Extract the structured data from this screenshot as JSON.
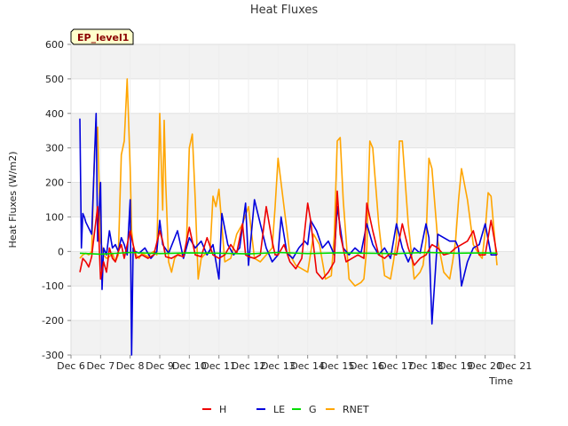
{
  "chart_data": {
    "type": "line",
    "title": "Heat Fluxes",
    "badge": "EP_level1",
    "xlabel": "Time",
    "ylabel": "Heat Fluxes (W/m2)",
    "xlim": [
      6,
      21
    ],
    "ylim": [
      -300,
      600
    ],
    "x_ticks": [
      6,
      7,
      8,
      9,
      10,
      11,
      12,
      13,
      14,
      15,
      16,
      17,
      18,
      19,
      20,
      21
    ],
    "x_tick_labels": [
      "Dec 6",
      "Dec 7",
      "Dec 8",
      "Dec 9",
      "Dec 10",
      "Dec 11",
      "Dec 12",
      "Dec 13",
      "Dec 14",
      "Dec 15",
      "Dec 16",
      "Dec 17",
      "Dec 18",
      "Dec 19",
      "Dec 20",
      "Dec 21"
    ],
    "y_ticks": [
      -300,
      -200,
      -100,
      0,
      100,
      200,
      300,
      400,
      500,
      600
    ],
    "y_tick_labels": [
      "-300",
      "-200",
      "-100",
      "0",
      "100",
      "200",
      "300",
      "400",
      "500",
      "600"
    ],
    "grid": true,
    "legend_position": "bottom",
    "series": [
      {
        "name": "H",
        "color": "#ee0000",
        "x": [
          6.3,
          6.4,
          6.5,
          6.6,
          6.7,
          6.8,
          6.9,
          7.0,
          7.1,
          7.2,
          7.3,
          7.4,
          7.5,
          7.6,
          7.7,
          7.8,
          8.0,
          8.2,
          8.4,
          8.6,
          8.8,
          9.0,
          9.1,
          9.2,
          9.4,
          9.6,
          9.8,
          10.0,
          10.2,
          10.4,
          10.6,
          10.8,
          11.0,
          11.2,
          11.4,
          11.6,
          11.8,
          11.9,
          12.0,
          12.2,
          12.4,
          12.6,
          12.8,
          12.9,
          13.0,
          13.2,
          13.4,
          13.6,
          13.8,
          14.0,
          14.1,
          14.3,
          14.5,
          14.7,
          14.9,
          15.0,
          15.1,
          15.3,
          15.5,
          15.7,
          15.9,
          16.0,
          16.2,
          16.4,
          16.6,
          16.8,
          17.0,
          17.2,
          17.4,
          17.6,
          17.8,
          18.0,
          18.2,
          18.4,
          18.6,
          18.8,
          19.0,
          19.2,
          19.4,
          19.6,
          19.8,
          20.0,
          20.2,
          20.4
        ],
        "y": [
          -60,
          -20,
          -30,
          -45,
          -15,
          60,
          130,
          -80,
          -30,
          -60,
          10,
          -20,
          -30,
          0,
          20,
          -20,
          60,
          -20,
          -10,
          -20,
          -10,
          60,
          30,
          -15,
          -20,
          -10,
          -15,
          70,
          -10,
          -15,
          40,
          -10,
          -20,
          -10,
          20,
          -5,
          80,
          -10,
          -15,
          -20,
          -10,
          130,
          30,
          -10,
          -10,
          20,
          -30,
          -50,
          -20,
          140,
          90,
          -60,
          -80,
          -60,
          -30,
          175,
          50,
          -30,
          -20,
          -10,
          -20,
          140,
          60,
          -10,
          -20,
          -5,
          -10,
          80,
          10,
          -40,
          -20,
          -10,
          20,
          10,
          -10,
          -5,
          10,
          20,
          30,
          60,
          -10,
          -10,
          90,
          -10
        ],
        "lw": 1.6
      },
      {
        "name": "LE",
        "color": "#0000dd",
        "x": [
          6.3,
          6.35,
          6.4,
          6.45,
          6.5,
          6.7,
          6.85,
          6.9,
          7.0,
          7.05,
          7.1,
          7.2,
          7.3,
          7.4,
          7.5,
          7.6,
          7.7,
          7.8,
          7.9,
          8.0,
          8.05,
          8.1,
          8.15,
          8.3,
          8.5,
          8.7,
          8.9,
          9.0,
          9.1,
          9.3,
          9.6,
          9.8,
          10.0,
          10.2,
          10.4,
          10.6,
          10.8,
          11.0,
          11.1,
          11.3,
          11.5,
          11.7,
          11.9,
          12.0,
          12.2,
          12.4,
          12.6,
          12.8,
          13.0,
          13.1,
          13.3,
          13.5,
          13.7,
          13.9,
          14.0,
          14.1,
          14.3,
          14.5,
          14.7,
          14.9,
          15.0,
          15.2,
          15.4,
          15.6,
          15.8,
          16.0,
          16.2,
          16.4,
          16.6,
          16.8,
          17.0,
          17.2,
          17.4,
          17.6,
          17.8,
          18.0,
          18.1,
          18.2,
          18.4,
          18.6,
          18.8,
          19.0,
          19.1,
          19.2,
          19.4,
          19.6,
          19.8,
          20.0,
          20.2,
          20.4
        ],
        "y": [
          385,
          10,
          110,
          100,
          85,
          50,
          400,
          30,
          200,
          -110,
          10,
          -10,
          60,
          10,
          20,
          0,
          40,
          20,
          -10,
          150,
          -300,
          10,
          0,
          -5,
          10,
          -20,
          0,
          90,
          20,
          -5,
          60,
          -20,
          40,
          10,
          30,
          -10,
          20,
          -80,
          110,
          20,
          -10,
          10,
          140,
          -40,
          150,
          80,
          10,
          -30,
          -10,
          100,
          -5,
          -20,
          10,
          30,
          20,
          90,
          60,
          10,
          30,
          -10,
          130,
          10,
          -10,
          10,
          -5,
          80,
          20,
          -10,
          10,
          -20,
          80,
          10,
          -30,
          10,
          -5,
          80,
          40,
          -210,
          50,
          40,
          30,
          30,
          10,
          -100,
          -30,
          10,
          20,
          80,
          -10,
          -10
        ],
        "lw": 1.6
      },
      {
        "name": "G",
        "color": "#00dd00",
        "x": [
          6.3,
          7.0,
          8.0,
          9.0,
          10.0,
          11.0,
          12.0,
          13.0,
          14.0,
          15.0,
          16.0,
          17.0,
          18.0,
          19.0,
          20.0,
          20.4
        ],
        "y": [
          -5,
          -8,
          -3,
          -6,
          -4,
          -5,
          -7,
          -3,
          -6,
          -4,
          -5,
          -6,
          -3,
          -5,
          -4,
          -5
        ],
        "lw": 1.6
      },
      {
        "name": "RNET",
        "color": "#ffa500",
        "x": [
          6.3,
          6.4,
          6.5,
          6.6,
          6.7,
          6.8,
          6.9,
          7.0,
          7.1,
          7.2,
          7.3,
          7.4,
          7.5,
          7.6,
          7.7,
          7.8,
          7.9,
          8.0,
          8.05,
          8.1,
          8.2,
          8.3,
          8.4,
          8.5,
          8.6,
          8.7,
          8.8,
          8.9,
          9.0,
          9.1,
          9.15,
          9.2,
          9.3,
          9.4,
          9.5,
          9.6,
          9.7,
          9.8,
          9.9,
          10.0,
          10.1,
          10.2,
          10.3,
          10.4,
          10.5,
          10.6,
          10.7,
          10.8,
          10.9,
          11.0,
          11.2,
          11.4,
          11.6,
          11.8,
          12.0,
          12.2,
          12.4,
          12.6,
          12.8,
          12.9,
          13.0,
          13.2,
          13.4,
          13.6,
          13.8,
          14.0,
          14.2,
          14.4,
          14.6,
          14.8,
          14.9,
          15.0,
          15.1,
          15.2,
          15.4,
          15.6,
          15.8,
          15.9,
          16.0,
          16.1,
          16.2,
          16.4,
          16.6,
          16.8,
          16.9,
          17.0,
          17.1,
          17.2,
          17.4,
          17.6,
          17.8,
          17.9,
          18.0,
          18.1,
          18.2,
          18.4,
          18.6,
          18.8,
          18.9,
          19.0,
          19.1,
          19.2,
          19.4,
          19.6,
          19.8,
          19.9,
          20.0,
          20.1,
          20.2,
          20.4
        ],
        "y": [
          -20,
          -10,
          -5,
          -10,
          0,
          300,
          360,
          30,
          -10,
          -20,
          -15,
          -5,
          -30,
          -10,
          280,
          320,
          500,
          240,
          60,
          20,
          -10,
          -20,
          -5,
          -10,
          -15,
          -5,
          0,
          -10,
          400,
          120,
          380,
          200,
          -30,
          -60,
          -20,
          -10,
          -5,
          -10,
          10,
          300,
          340,
          150,
          -80,
          -20,
          -10,
          -5,
          0,
          160,
          130,
          180,
          -30,
          -20,
          50,
          80,
          130,
          -20,
          -30,
          -10,
          10,
          130,
          270,
          130,
          -10,
          -40,
          -50,
          -60,
          50,
          20,
          -80,
          -70,
          50,
          320,
          330,
          150,
          -80,
          -100,
          -90,
          -80,
          10,
          320,
          300,
          80,
          -70,
          -80,
          -30,
          30,
          320,
          320,
          80,
          -80,
          -60,
          -40,
          30,
          270,
          240,
          30,
          -60,
          -80,
          -30,
          30,
          150,
          240,
          150,
          20,
          -10,
          -20,
          60,
          170,
          160,
          -40
        ]
      }
    ]
  }
}
